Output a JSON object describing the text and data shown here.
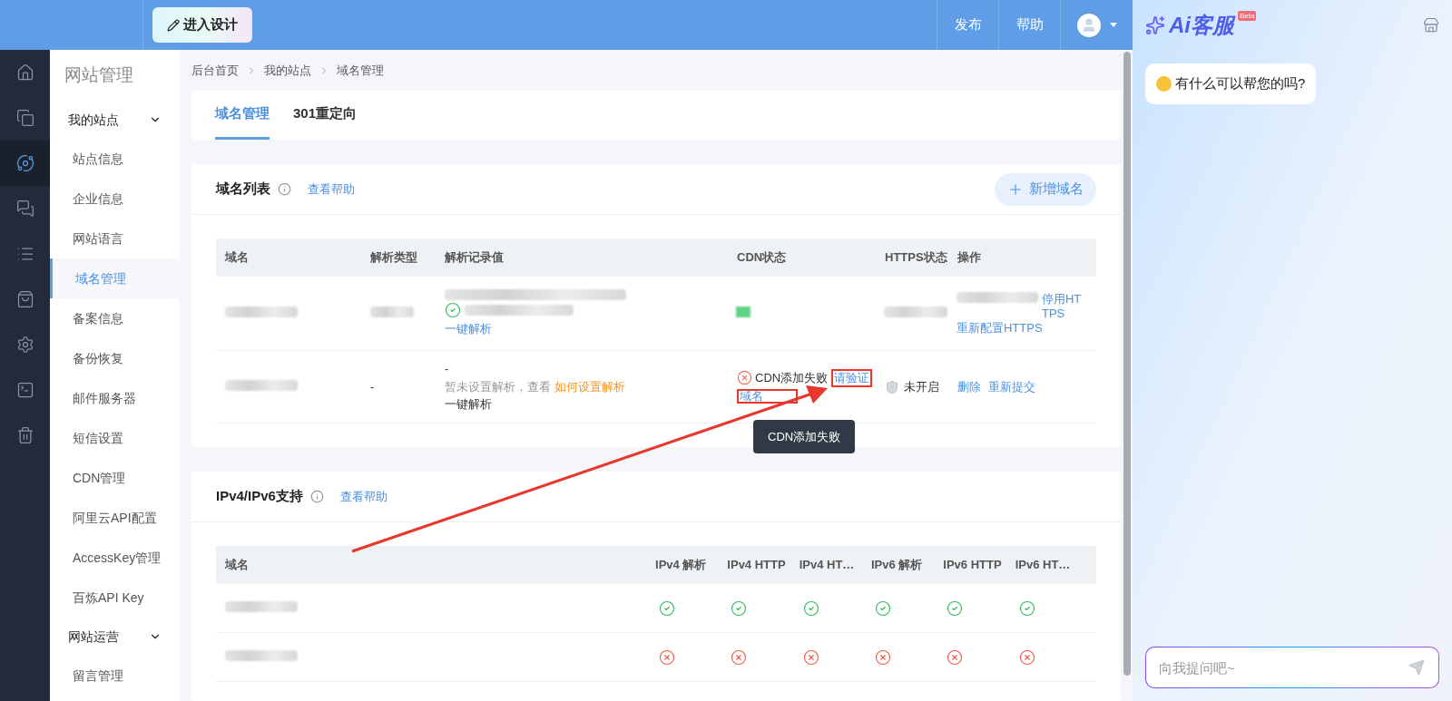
{
  "topbar": {
    "design_button": "进入设计",
    "actions": [
      "发布",
      "帮助"
    ]
  },
  "rail": [
    {
      "selected": false
    },
    {
      "selected": false
    },
    {
      "selected": true
    },
    {
      "selected": false
    },
    {
      "selected": false
    },
    {
      "selected": false
    },
    {
      "selected": false
    },
    {
      "selected": false
    },
    {
      "selected": false
    }
  ],
  "sidebar": {
    "title": "网站管理",
    "groups": [
      {
        "label": "我的站点",
        "expanded": true,
        "items": [
          {
            "label": "站点信息",
            "selected": false
          },
          {
            "label": "企业信息",
            "selected": false
          },
          {
            "label": "网站语言",
            "selected": false
          },
          {
            "label": "域名管理",
            "selected": true
          },
          {
            "label": "备案信息",
            "selected": false
          },
          {
            "label": "备份恢复",
            "selected": false
          },
          {
            "label": "邮件服务器",
            "selected": false
          },
          {
            "label": "短信设置",
            "selected": false
          },
          {
            "label": "CDN管理",
            "selected": false
          },
          {
            "label": "阿里云API配置",
            "selected": false
          },
          {
            "label": "AccessKey管理",
            "selected": false
          },
          {
            "label": "百炼API Key",
            "selected": false
          }
        ]
      },
      {
        "label": "网站运营",
        "expanded": true,
        "items": [
          {
            "label": "留言管理",
            "selected": false
          }
        ]
      }
    ]
  },
  "breadcrumb": [
    "后台首页",
    "我的站点",
    "域名管理"
  ],
  "tabs": [
    {
      "label": "域名管理",
      "selected": true
    },
    {
      "label": "301重定向",
      "selected": false
    }
  ],
  "domain_list": {
    "title": "域名列表",
    "help": "查看帮助",
    "add_button": "新增域名",
    "columns": [
      "域名",
      "解析类型",
      "解析记录值",
      "CDN状态",
      "HTTPS状态",
      "操作"
    ],
    "rows": [
      {
        "kind": "active",
        "record_link": "一键解析",
        "actions": [
          "停用HTTPS",
          "重新配置HTTPS"
        ]
      },
      {
        "kind": "failed",
        "type": "-",
        "record": "-",
        "record_hint": "暂未设置解析，查看",
        "record_hint_link": "如何设置解析",
        "record_action": "一键解析",
        "cdn_status": "CDN添加失败",
        "cdn_link_lines": [
          "请验证",
          "域名"
        ],
        "cdn_link_highlighted": true,
        "tooltip": "CDN添加失败",
        "https_status": "未开启",
        "actions": [
          "删除",
          "重新提交"
        ]
      }
    ]
  },
  "ip_support": {
    "title": "IPv4/IPv6支持",
    "help": "查看帮助",
    "columns": [
      "域名",
      "IPv4 解析",
      "IPv4 HTTP",
      "IPv4 HT…",
      "IPv6 解析",
      "IPv6 HTTP",
      "IPv6 HT…"
    ],
    "rows": [
      {
        "checks": [
          true,
          true,
          true,
          true,
          true,
          true
        ]
      },
      {
        "checks": [
          false,
          false,
          false,
          false,
          false,
          false
        ]
      }
    ]
  },
  "assistant": {
    "logo": "Ai客服",
    "badge": "Beta",
    "greeting": "有什么可以帮您的吗?",
    "input_placeholder": "向我提问吧~"
  }
}
